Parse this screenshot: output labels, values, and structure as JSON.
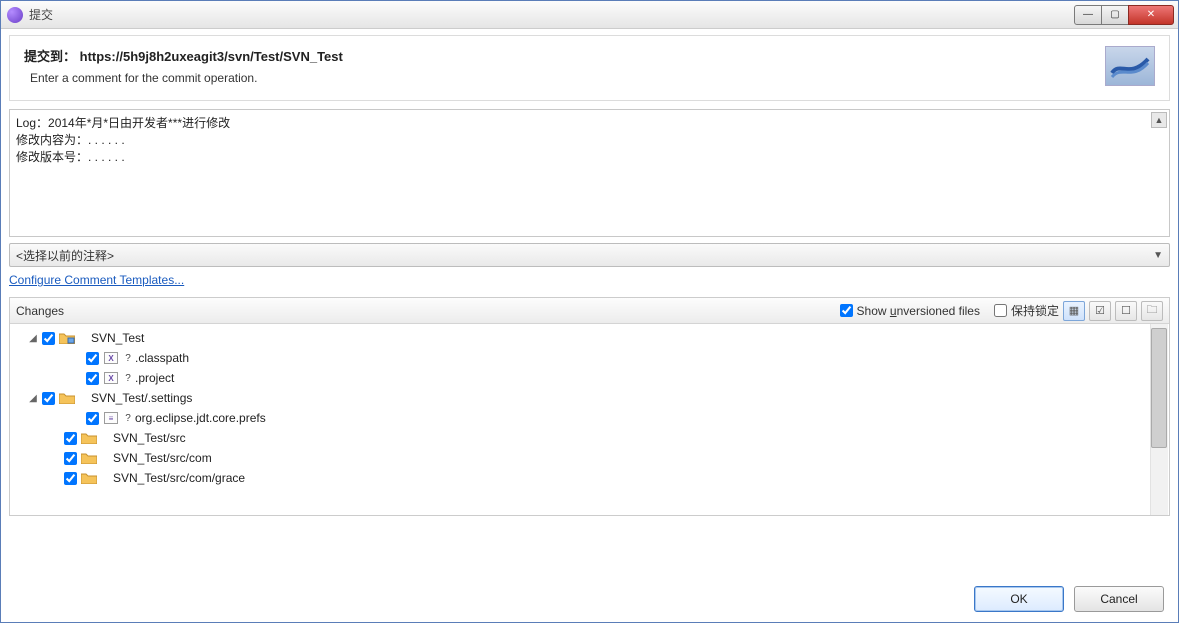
{
  "window": {
    "title": "提交"
  },
  "header": {
    "title_prefix": "提交到：",
    "url": "https://5h9j8h2uxeagit3/svn/Test/SVN_Test",
    "subtitle": "Enter a comment for the commit operation."
  },
  "comment": {
    "text": "Log：2014年*月*日由开发者***进行修改\n修改内容为：. . . . . .\n修改版本号：. . . . . ."
  },
  "previous_comment_combo": {
    "placeholder": "<选择以前的注释>"
  },
  "links": {
    "configure_templates": "Configure Comment Templates..."
  },
  "changes": {
    "title": "Changes",
    "show_unversioned_label": "Show unversioned files",
    "show_unversioned_checked": true,
    "keep_locks_label": "保持锁定",
    "keep_locks_checked": false,
    "tree": [
      {
        "indent": 0,
        "expander": "open",
        "checked": true,
        "icon": "folder-share",
        "status": "",
        "label": "SVN_Test"
      },
      {
        "indent": 2,
        "expander": "none",
        "checked": true,
        "icon": "file-x",
        "status": "?",
        "label": ".classpath"
      },
      {
        "indent": 2,
        "expander": "none",
        "checked": true,
        "icon": "file-x",
        "status": "?",
        "label": ".project"
      },
      {
        "indent": 0,
        "expander": "open",
        "checked": true,
        "icon": "folder",
        "status": "",
        "label": "SVN_Test/.settings"
      },
      {
        "indent": 2,
        "expander": "none",
        "checked": true,
        "icon": "file",
        "status": "?",
        "label": "org.eclipse.jdt.core.prefs"
      },
      {
        "indent": 1,
        "expander": "none",
        "checked": true,
        "icon": "folder",
        "status": "",
        "label": "SVN_Test/src"
      },
      {
        "indent": 1,
        "expander": "none",
        "checked": true,
        "icon": "folder",
        "status": "",
        "label": "SVN_Test/src/com"
      },
      {
        "indent": 1,
        "expander": "none",
        "checked": true,
        "icon": "folder",
        "status": "",
        "label": "SVN_Test/src/com/grace"
      }
    ]
  },
  "buttons": {
    "ok": "OK",
    "cancel": "Cancel"
  }
}
